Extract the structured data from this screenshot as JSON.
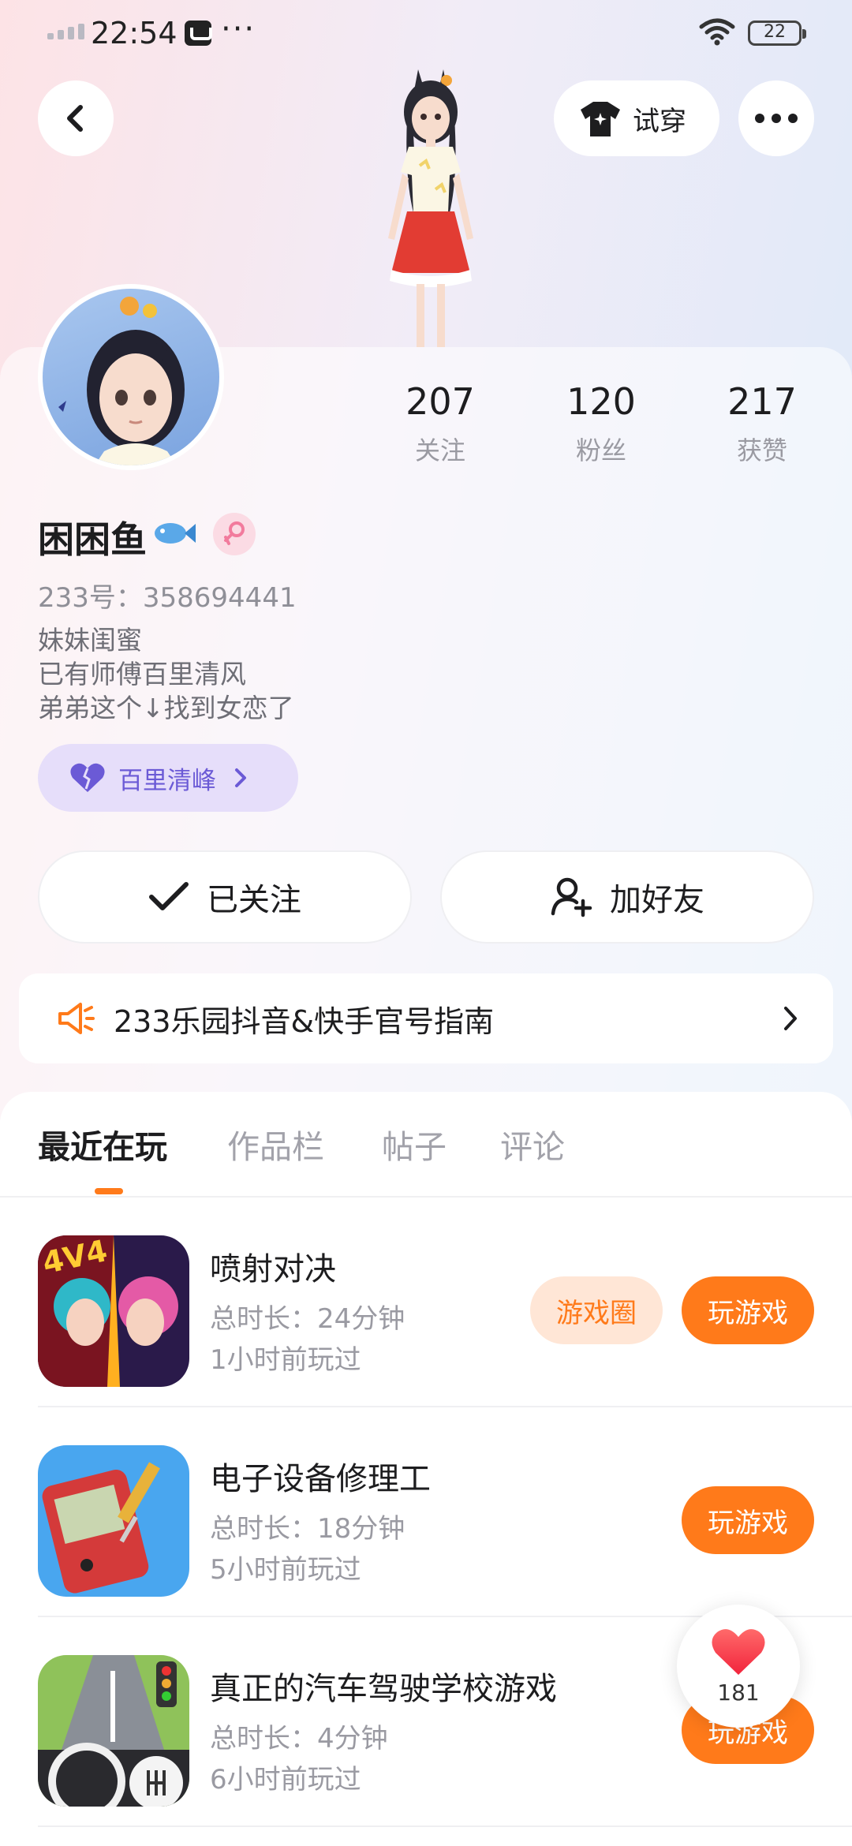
{
  "status_bar": {
    "time": "22:54",
    "more": "···",
    "battery": "22"
  },
  "header": {
    "back_icon": "chevron-left-icon",
    "tryon_label": "试穿",
    "more_icon": "more-horizontal-icon"
  },
  "profile": {
    "nickname": "困困鱼",
    "uid": "233号：358694441",
    "bio": [
      "妹妹闺蜜",
      "已有师傅百里清风",
      "弟弟这个↓找到女恋了"
    ],
    "stats": [
      {
        "num": "207",
        "label": "关注"
      },
      {
        "num": "120",
        "label": "粉丝"
      },
      {
        "num": "217",
        "label": "获赞"
      }
    ],
    "cp_label": "百里清峰"
  },
  "actions": {
    "follow_label": "已关注",
    "add_friend_label": "加好友"
  },
  "notice": {
    "text": "233乐园抖音&快手官号指南"
  },
  "tabs": [
    {
      "label": "最近在玩"
    },
    {
      "label": "作品栏"
    },
    {
      "label": "帖子"
    },
    {
      "label": "评论"
    }
  ],
  "games": [
    {
      "name": "喷射对决",
      "duration": "总时长：24分钟",
      "last_played": "1小时前玩过",
      "circle_label": "游戏圈",
      "play_label": "玩游戏"
    },
    {
      "name": "电子设备修理工",
      "duration": "总时长：18分钟",
      "last_played": "5小时前玩过",
      "play_label": "玩游戏"
    },
    {
      "name": "真正的汽车驾驶学校游戏",
      "duration": "总时长：4分钟",
      "last_played": "6小时前玩过",
      "play_label": "玩游戏"
    }
  ],
  "like_float": {
    "count": "181"
  },
  "colors": {
    "accent": "#ff7a1a",
    "cp_purple": "#6b5ad6"
  }
}
